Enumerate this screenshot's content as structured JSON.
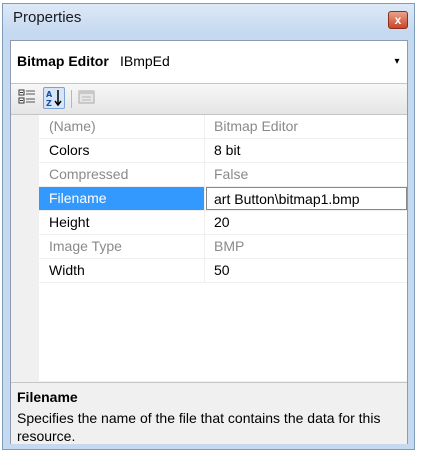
{
  "window": {
    "title": "Properties",
    "close_glyph": "x"
  },
  "object_selector": {
    "name": "Bitmap Editor",
    "type": "IBmpEd",
    "dropdown_glyph": "▾"
  },
  "toolbar": {
    "buttons": [
      {
        "icon": "categorized-icon"
      },
      {
        "icon": "alphabetical-icon"
      },
      {
        "icon": "property-pages-icon"
      }
    ]
  },
  "properties": [
    {
      "name": "(Name)",
      "value": "Bitmap Editor",
      "readonly": true
    },
    {
      "name": "Colors",
      "value": "8 bit",
      "readonly": false
    },
    {
      "name": "Compressed",
      "value": "False",
      "readonly": true
    },
    {
      "name": "Filename",
      "value": "art Button\\bitmap1.bmp",
      "readonly": false,
      "selected": true
    },
    {
      "name": "Height",
      "value": "20",
      "readonly": false
    },
    {
      "name": "Image Type",
      "value": "BMP",
      "readonly": true
    },
    {
      "name": "Width",
      "value": "50",
      "readonly": false
    }
  ],
  "help": {
    "title": "Filename",
    "description": "Specifies the name of the file that contains the data for this resource."
  },
  "colors": {
    "selection": "#3399ff",
    "readonly_text": "#8a8a8a",
    "title_bar": "#c6d9f1"
  }
}
